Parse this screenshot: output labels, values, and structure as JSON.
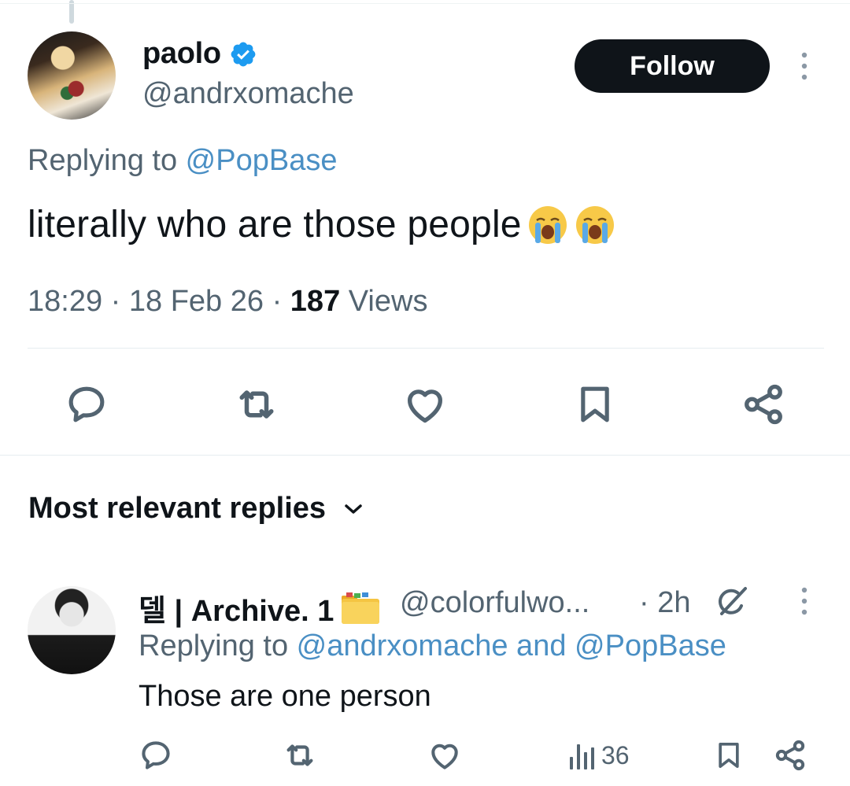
{
  "tweet": {
    "display_name": "paolo",
    "handle": "@andrxomache",
    "follow_label": "Follow",
    "replying_prefix": "Replying to ",
    "replying_to": "@PopBase",
    "text": "literally who are those people",
    "time": "18:29",
    "date": "18 Feb 26",
    "separator": "·",
    "views_count": "187",
    "views_label": "Views"
  },
  "icons": {
    "verified": "verified-badge-icon",
    "reply": "comment-bubble-icon",
    "retweet": "retweet-icon",
    "like": "heart-icon",
    "bookmark": "bookmark-icon",
    "share": "share-icon",
    "more": "more-vertical-icon",
    "emoji": "loudly-crying-face-emoji",
    "folder": "folder-emoji",
    "grok": "grok-icon",
    "views": "views-bar-icon",
    "chevron": "chevron-down-icon"
  },
  "replies_section": {
    "sort_label": "Most relevant replies"
  },
  "reply": {
    "display_name": "델 | Archive. 1",
    "handle": "@colorfulwo...",
    "time": "· 2h",
    "replying_prefix": "Replying to ",
    "replying_to_1": "@andrxomache",
    "replying_and": " and ",
    "replying_to_2": "@PopBase",
    "text": "Those are one person",
    "views_count": "36"
  },
  "colors": {
    "text_primary": "#0f1419",
    "text_secondary": "#536471",
    "link": "#4a8fc4",
    "verified": "#1d9bf0",
    "follow_bg": "#0f1419"
  }
}
